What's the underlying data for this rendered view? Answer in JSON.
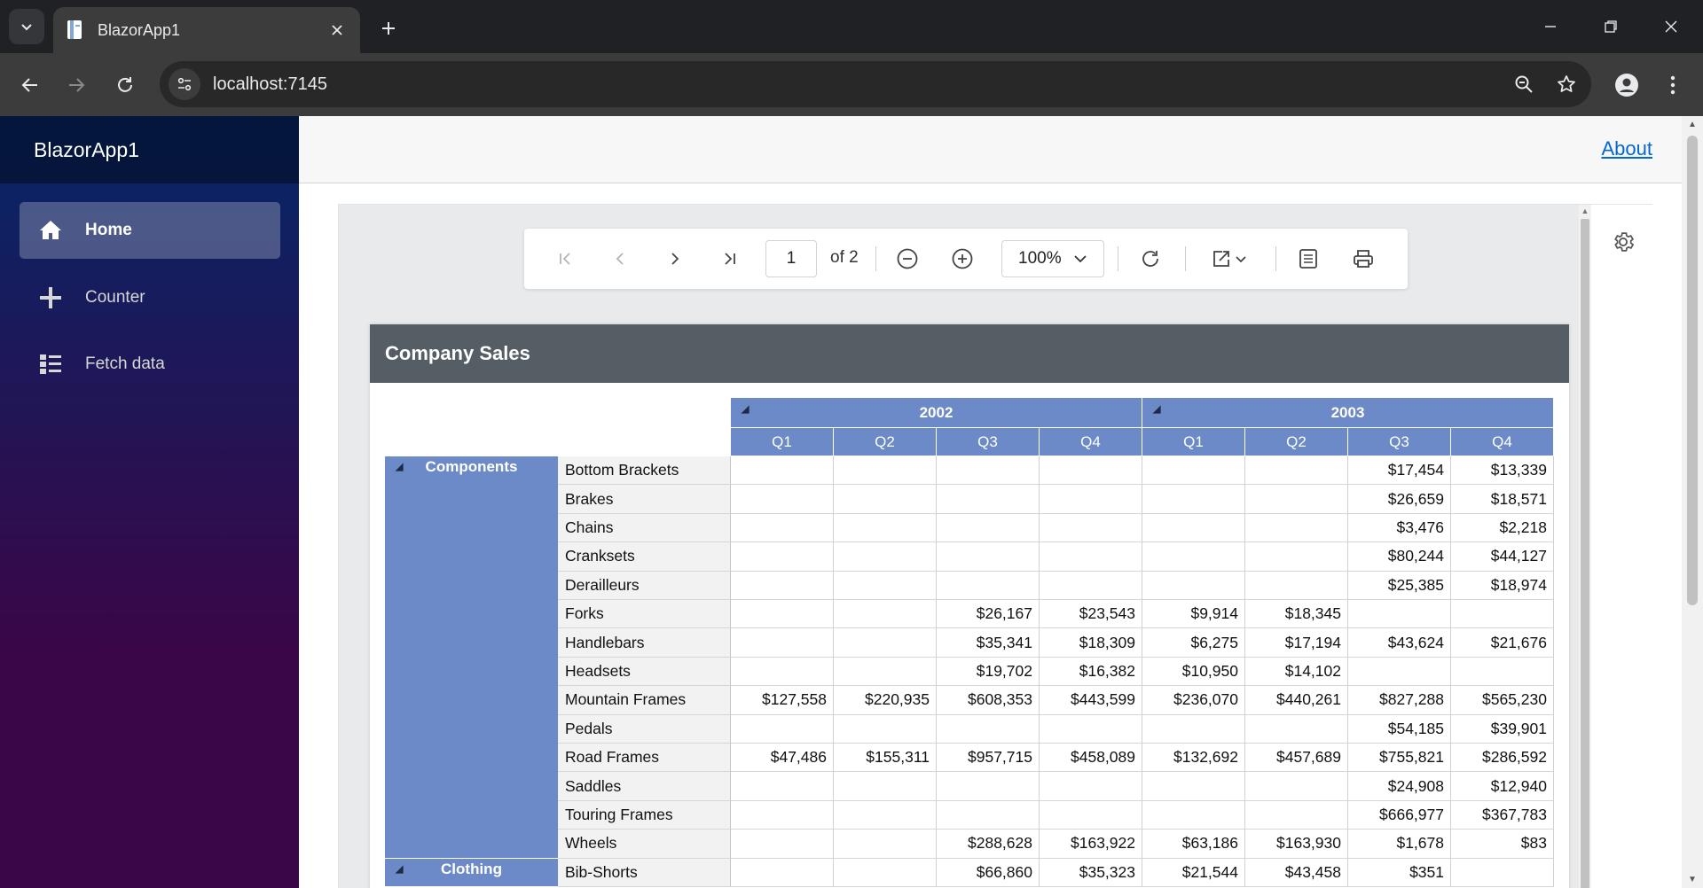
{
  "browser": {
    "tab_title": "BlazorApp1",
    "url": "localhost:7145"
  },
  "app": {
    "brand": "BlazorApp1",
    "nav": [
      {
        "label": "Home",
        "icon": "home-icon",
        "active": true
      },
      {
        "label": "Counter",
        "icon": "plus-icon",
        "active": false
      },
      {
        "label": "Fetch data",
        "icon": "list-icon",
        "active": false
      }
    ],
    "about_label": "About"
  },
  "viewer": {
    "page_number": "1",
    "page_of": "of 2",
    "zoom": "100%"
  },
  "report": {
    "title": "Company Sales",
    "years": [
      "2002",
      "2003"
    ],
    "quarters": [
      "Q1",
      "Q2",
      "Q3",
      "Q4",
      "Q1",
      "Q2",
      "Q3",
      "Q4"
    ],
    "categories": [
      {
        "name": "Components",
        "row_start": 0,
        "row_count": 14
      },
      {
        "name": "Clothing",
        "row_start": 14,
        "row_count": 1
      }
    ],
    "rows": [
      {
        "product": "Bottom Brackets",
        "values": [
          "",
          "",
          "",
          "",
          "",
          "",
          "$17,454",
          "$13,339"
        ]
      },
      {
        "product": "Brakes",
        "values": [
          "",
          "",
          "",
          "",
          "",
          "",
          "$26,659",
          "$18,571"
        ]
      },
      {
        "product": "Chains",
        "values": [
          "",
          "",
          "",
          "",
          "",
          "",
          "$3,476",
          "$2,218"
        ]
      },
      {
        "product": "Cranksets",
        "values": [
          "",
          "",
          "",
          "",
          "",
          "",
          "$80,244",
          "$44,127"
        ]
      },
      {
        "product": "Derailleurs",
        "values": [
          "",
          "",
          "",
          "",
          "",
          "",
          "$25,385",
          "$18,974"
        ]
      },
      {
        "product": "Forks",
        "values": [
          "",
          "",
          "$26,167",
          "$23,543",
          "$9,914",
          "$18,345",
          "",
          ""
        ]
      },
      {
        "product": "Handlebars",
        "values": [
          "",
          "",
          "$35,341",
          "$18,309",
          "$6,275",
          "$17,194",
          "$43,624",
          "$21,676"
        ]
      },
      {
        "product": "Headsets",
        "values": [
          "",
          "",
          "$19,702",
          "$16,382",
          "$10,950",
          "$14,102",
          "",
          ""
        ]
      },
      {
        "product": "Mountain Frames",
        "values": [
          "$127,558",
          "$220,935",
          "$608,353",
          "$443,599",
          "$236,070",
          "$440,261",
          "$827,288",
          "$565,230"
        ]
      },
      {
        "product": "Pedals",
        "values": [
          "",
          "",
          "",
          "",
          "",
          "",
          "$54,185",
          "$39,901"
        ]
      },
      {
        "product": "Road Frames",
        "values": [
          "$47,486",
          "$155,311",
          "$957,715",
          "$458,089",
          "$132,692",
          "$457,689",
          "$755,821",
          "$286,592"
        ]
      },
      {
        "product": "Saddles",
        "values": [
          "",
          "",
          "",
          "",
          "",
          "",
          "$24,908",
          "$12,940"
        ]
      },
      {
        "product": "Touring Frames",
        "values": [
          "",
          "",
          "",
          "",
          "",
          "",
          "$666,977",
          "$367,783"
        ]
      },
      {
        "product": "Wheels",
        "values": [
          "",
          "",
          "$288,628",
          "$163,922",
          "$63,186",
          "$163,930",
          "$1,678",
          "$83"
        ]
      },
      {
        "product": "Bib-Shorts",
        "values": [
          "",
          "",
          "$66,860",
          "$35,323",
          "$21,544",
          "$43,458",
          "$351",
          ""
        ]
      }
    ]
  }
}
